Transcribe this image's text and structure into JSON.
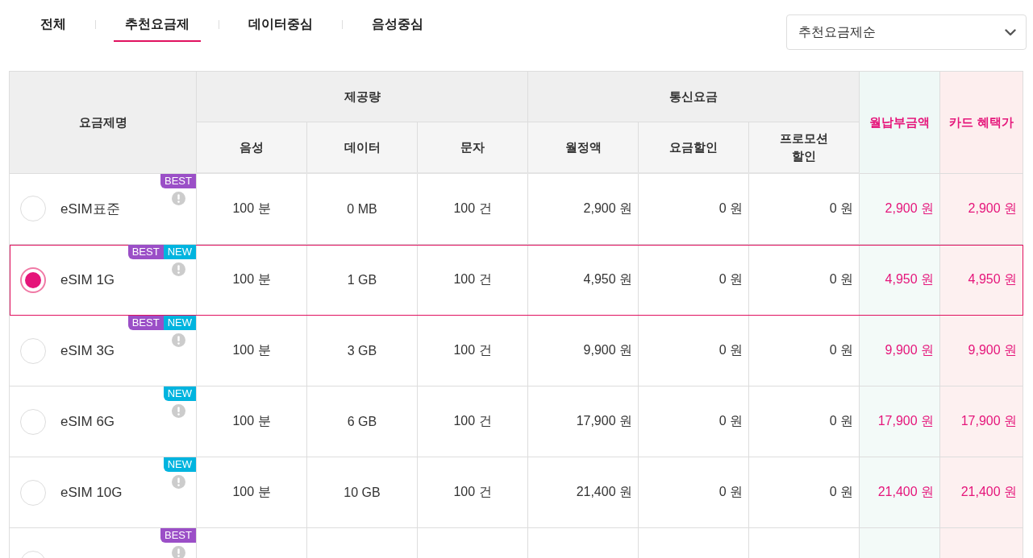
{
  "tabs": [
    {
      "label": "전체",
      "selected": false
    },
    {
      "label": "추천요금제",
      "selected": true
    },
    {
      "label": "데이터중심",
      "selected": false
    },
    {
      "label": "음성중심",
      "selected": false
    }
  ],
  "sort_select": {
    "value": "추천요금제순"
  },
  "table": {
    "name_header": "요금제명",
    "groups": [
      {
        "label": "제공량",
        "columns": [
          "음성",
          "데이터",
          "문자"
        ]
      },
      {
        "label": "통신요금",
        "columns": [
          "월정액",
          "요금할인",
          "프로모션\n할인"
        ]
      }
    ],
    "highlight_columns": [
      {
        "kind": "monthly",
        "label": "월납부금액"
      },
      {
        "kind": "card",
        "label": "카드 혜택가"
      }
    ],
    "rows": [
      {
        "name": "eSIM표준",
        "selected": false,
        "badges": [
          {
            "kind": "best",
            "label": "BEST"
          }
        ],
        "voice": "100 분",
        "data": "0 MB",
        "sms": "100 건",
        "monthly_fee": "2,900 원",
        "fee_discount": "0 원",
        "promo_discount": "0 원",
        "monthly_payment": "2,900 원",
        "card_price": "2,900 원"
      },
      {
        "name": "eSIM 1G",
        "selected": true,
        "badges": [
          {
            "kind": "best",
            "label": "BEST"
          },
          {
            "kind": "new",
            "label": "NEW"
          }
        ],
        "voice": "100 분",
        "data": "1 GB",
        "sms": "100 건",
        "monthly_fee": "4,950 원",
        "fee_discount": "0 원",
        "promo_discount": "0 원",
        "monthly_payment": "4,950 원",
        "card_price": "4,950 원"
      },
      {
        "name": "eSIM 3G",
        "selected": false,
        "badges": [
          {
            "kind": "best",
            "label": "BEST"
          },
          {
            "kind": "new",
            "label": "NEW"
          }
        ],
        "voice": "100 분",
        "data": "3 GB",
        "sms": "100 건",
        "monthly_fee": "9,900 원",
        "fee_discount": "0 원",
        "promo_discount": "0 원",
        "monthly_payment": "9,900 원",
        "card_price": "9,900 원"
      },
      {
        "name": "eSIM 6G",
        "selected": false,
        "badges": [
          {
            "kind": "new",
            "label": "NEW"
          }
        ],
        "voice": "100 분",
        "data": "6 GB",
        "sms": "100 건",
        "monthly_fee": "17,900 원",
        "fee_discount": "0 원",
        "promo_discount": "0 원",
        "monthly_payment": "17,900 원",
        "card_price": "17,900 원"
      },
      {
        "name": "eSIM 10G",
        "selected": false,
        "badges": [
          {
            "kind": "new",
            "label": "NEW"
          }
        ],
        "voice": "100 분",
        "data": "10 GB",
        "sms": "100 건",
        "monthly_fee": "21,400 원",
        "fee_discount": "0 원",
        "promo_discount": "0 원",
        "monthly_payment": "21,400 원",
        "card_price": "21,400 원"
      },
      {
        "selected": false,
        "badges": [
          {
            "kind": "best",
            "label": "BEST"
          }
        ]
      }
    ]
  }
}
